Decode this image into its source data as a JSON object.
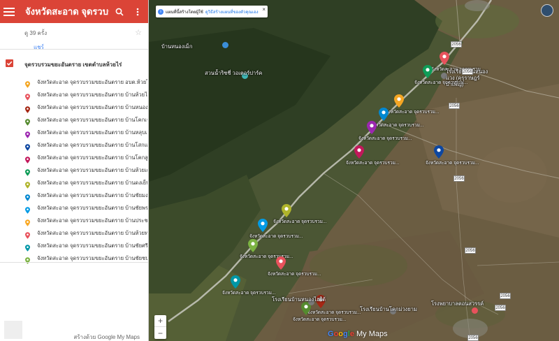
{
  "header": {
    "title": "จังหวัดสะอาด จุดรวบรวมขยะอันตราย",
    "menu_icon": "hamburger-icon",
    "search_icon": "search-icon",
    "more_icon": "more-vert-icon"
  },
  "meta": {
    "views": "ดู 39 ครั้ง",
    "share": "แชร์"
  },
  "layer": {
    "name": "จุดรวบรวมขยะอันตราย เขตตำบลห้วยไร่",
    "checked": true
  },
  "items": [
    {
      "label": "จังหวัดสะอาด จุดรวบรวมขยะอันตราย อบต.ห้วยไร่",
      "color": "#f4a623"
    },
    {
      "label": "จังหวัดสะอาด จุดรวบรวมขยะอันตราย บ้านห้วยไร่",
      "color": "#e8525c"
    },
    {
      "label": "จังหวัดสะอาด จุดรวบรวมขยะอันตราย บ้านหนองแวง",
      "color": "#a52714"
    },
    {
      "label": "จังหวัดสะอาด จุดรวบรวมขยะอันตราย บ้านโคกเจริญ",
      "color": "#558b2f"
    },
    {
      "label": "จังหวัดสะอาด จุดรวบรวมขยะอันตราย บ้านหลุบเลา",
      "color": "#9c27b0"
    },
    {
      "label": "จังหวัดสะอาด จุดรวบรวมขยะอันตราย บ้านโสกแดง",
      "color": "#0d47a1"
    },
    {
      "label": "จังหวัดสะอาด จุดรวบรวมขยะอันตราย บ้านโคกสูง",
      "color": "#c2185b"
    },
    {
      "label": "จังหวัดสะอาด จุดรวบรวมขยะอันตราย บ้านห้วยเตย",
      "color": "#0f9d58"
    },
    {
      "label": "จังหวัดสะอาด จุดรวบรวมขยะอันตราย บ้านดงเย็น",
      "color": "#afb42b"
    },
    {
      "label": "จังหวัดสะอาด จุดรวบรวมขยะอันตราย บ้านชัยมงคล",
      "color": "#0288d1"
    },
    {
      "label": "จังหวัดสะอาด จุดรวบรวมขยะอันตราย บ้านชัยพร",
      "color": "#039be5"
    },
    {
      "label": "จังหวัดสะอาด จุดรวบรวมขยะอันตราย บ้านประชาสุข",
      "color": "#f9a825"
    },
    {
      "label": "จังหวัดสะอาด จุดรวบรวมขยะอันตราย บ้านห้วยทราย",
      "color": "#e8525c"
    },
    {
      "label": "จังหวัดสะอาด จุดรวบรวมขยะอันตราย บ้านชัยศรี",
      "color": "#0097a7"
    },
    {
      "label": "จังหวัดสะอาด จุดรวบรวมขยะอันตราย บ้านชัยชนะ",
      "color": "#7cb342"
    }
  ],
  "footer": {
    "created_with": "สร้างด้วย Google My Maps"
  },
  "map": {
    "notice": {
      "text": "แผนที่นี้สร้างโดยผู้ใช้",
      "link": "ดูวิธีสร้างแผนที่ของตัวคุณเอง"
    },
    "zoom_in": "+",
    "zoom_out": "−",
    "attribution": "Google My Maps",
    "pois": [
      {
        "label": "บ้านหนองเม็ก",
        "color": "#3b8ed8"
      },
      {
        "label": "สวนน้ำริชชี่ วอเตอร์ปาร์ค",
        "color": "#3fb5b5"
      },
      {
        "label": "โรงเรียนบ้านหนองแวง (คุรุราษฎร์บำเพ็ญ)",
        "color": "#7a7a7a"
      },
      {
        "label": "โรงเรียนบ้านหนองไฮใต้",
        "color": "#7a7a7a"
      },
      {
        "label": "โรงเรียนบ้านโคกม่วงยาม",
        "color": "#7a7a7a"
      },
      {
        "label": "โรงพยาบาลตอนสวรรค์",
        "color": "#e8525c"
      }
    ],
    "roads": [
      "2056",
      "2056",
      "2056",
      "2056",
      "2056",
      "2056",
      "2056",
      "2056"
    ],
    "markers": [
      {
        "label": "จังหวัดสะอาด จุดรวบรวม...",
        "color": "#e8525c"
      },
      {
        "label": "จังหวัดสะอาด จุดรวบรวม...",
        "color": "#0f9d58"
      },
      {
        "label": "จังหวัดสะอาด จุดรวบรวม...",
        "color": "#f4a623"
      },
      {
        "label": "จังหวัดสะอาด จุดรวบรวม...",
        "color": "#0288d1"
      },
      {
        "label": "จังหวัดสะอาด จุดรวบรวม...",
        "color": "#9c27b0"
      },
      {
        "label": "จังหวัดสะอาด จุดรวบรวม...",
        "color": "#c2185b"
      },
      {
        "label": "จังหวัดสะอาด จุดรวบรวม...",
        "color": "#0d47a1"
      },
      {
        "label": "จังหวัดสะอาด จุดรวบรวม...",
        "color": "#afb42b"
      },
      {
        "label": "จังหวัดสะอาด จุดรวบรวม...",
        "color": "#039be5"
      },
      {
        "label": "จังหวัดสะอาด จุดรวบรวม...",
        "color": "#7cb342"
      },
      {
        "label": "จังหวัดสะอาด จุดรวบรวม...",
        "color": "#e8525c"
      },
      {
        "label": "จังหวัดสะอาด จุดรวบรวม...",
        "color": "#0097a7"
      },
      {
        "label": "จังหวัดสะอาด จุดรวบรวม...",
        "color": "#a52714"
      },
      {
        "label": "จังหวัดสะอาด จุดรวบรวม...",
        "color": "#558b2f"
      }
    ]
  }
}
